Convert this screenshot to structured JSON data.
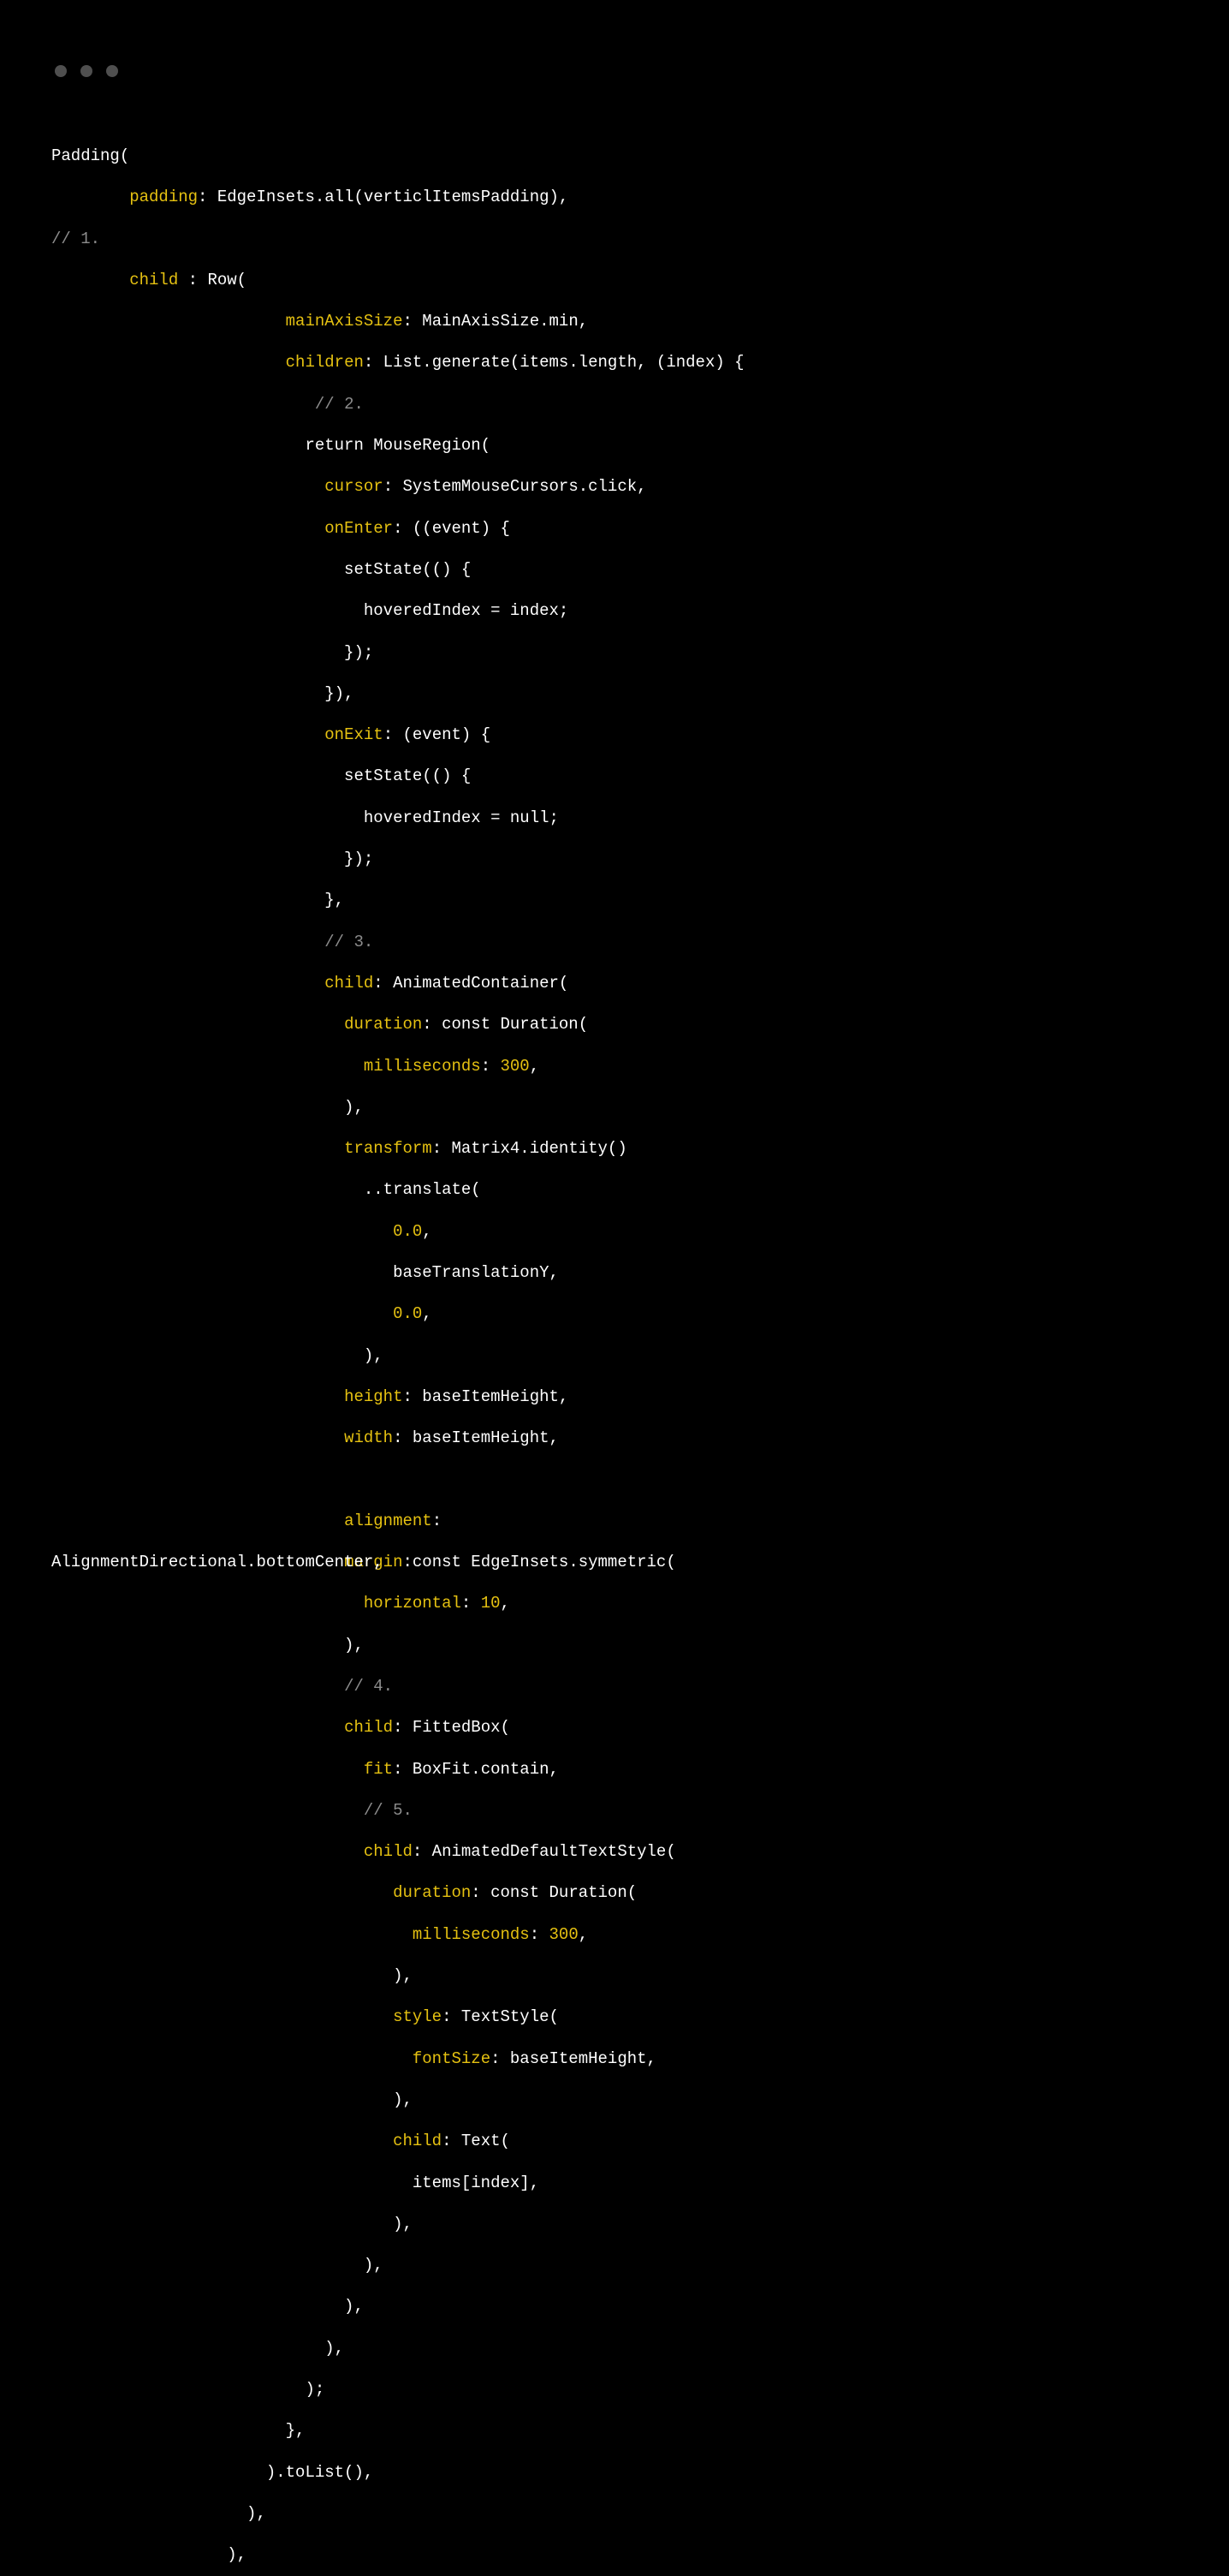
{
  "code": {
    "l01_a": "Padding(",
    "l02_a": "        ",
    "l02_key": "padding",
    "l02_b": ": EdgeInsets.all(verticlItemsPadding),",
    "l03_comment": "// 1.",
    "l04_a": "        ",
    "l04_key": "child",
    "l04_b": " : Row(",
    "l05_a": "                        ",
    "l05_key": "mainAxisSize",
    "l05_b": ": MainAxisSize.min,",
    "l06_a": "                        ",
    "l06_key": "children",
    "l06_b": ": List.generate(items.length, (index) {",
    "l07_a": "                           ",
    "l07_comment": "// 2.",
    "l08_a": "                          return MouseRegion(",
    "l09_a": "                            ",
    "l09_key": "cursor",
    "l09_b": ": SystemMouseCursors.click,",
    "l10_a": "                            ",
    "l10_key": "onEnter",
    "l10_b": ": ((event) {",
    "l11_a": "                              setState(() {",
    "l12_a": "                                hoveredIndex = index;",
    "l13_a": "                              });",
    "l14_a": "                            }),",
    "l15_a": "                            ",
    "l15_key": "onExit",
    "l15_b": ": (event) {",
    "l16_a": "                              setState(() {",
    "l17_a": "                                hoveredIndex = null;",
    "l18_a": "                              });",
    "l19_a": "                            },",
    "l20_a": "                            ",
    "l20_comment": "// 3.",
    "l21_a": "                            ",
    "l21_key": "child",
    "l21_b": ": AnimatedContainer(",
    "l22_a": "                              ",
    "l22_key": "duration",
    "l22_b": ": const Duration(",
    "l23_a": "                                ",
    "l23_key": "milliseconds",
    "l23_b": ": ",
    "l23_num": "300",
    "l23_c": ",",
    "l24_a": "                              ),",
    "l25_a": "                              ",
    "l25_key": "transform",
    "l25_b": ": Matrix4.identity()",
    "l26_a": "                                ..translate(",
    "l27_a": "                                   ",
    "l27_num": "0.0",
    "l27_b": ",",
    "l28_a": "                                   baseTranslationY,",
    "l29_a": "                                   ",
    "l29_num": "0.0",
    "l29_b": ",",
    "l30_a": "                                ),",
    "l31_a": "                              ",
    "l31_key": "height",
    "l31_b": ": baseItemHeight,",
    "l32_a": "                              ",
    "l32_key": "width",
    "l32_b": ": baseItemHeight,",
    "l33_blank": " ",
    "l34_mid": "                              ",
    "l34_key": "alignment",
    "l34_mid_b": ":",
    "l34_left": "AlignmentDirectional.bottomCenter,",
    "l35_mid_a": "                              ",
    "l35_mid_key": "margin",
    "l35_mid_b": ":const EdgeInsets.symmetric(",
    "l36_a": "                                ",
    "l36_key": "horizontal",
    "l36_b": ": ",
    "l36_num": "10",
    "l36_c": ",",
    "l37_a": "                              ),",
    "l38_a": "                              ",
    "l38_comment": "// 4.",
    "l39_a": "                              ",
    "l39_key": "child",
    "l39_b": ": FittedBox(",
    "l40_a": "                                ",
    "l40_key": "fit",
    "l40_b": ": BoxFit.contain,",
    "l41_a": "                                ",
    "l41_comment": "// 5.",
    "l42_a": "                                ",
    "l42_key": "child",
    "l42_b": ": AnimatedDefaultTextStyle(",
    "l43_a": "                                   ",
    "l43_key": "duration",
    "l43_b": ": const Duration(",
    "l44_a": "                                     ",
    "l44_key": "milliseconds",
    "l44_b": ": ",
    "l44_num": "300",
    "l44_c": ",",
    "l45_a": "                                   ),",
    "l46_a": "                                   ",
    "l46_key": "style",
    "l46_b": ": TextStyle(",
    "l47_a": "                                     ",
    "l47_key": "fontSize",
    "l47_b": ": baseItemHeight,",
    "l48_a": "                                   ),",
    "l49_a": "                                   ",
    "l49_key": "child",
    "l49_b": ": Text(",
    "l50_a": "                                     items[index],",
    "l51_a": "                                   ),",
    "l52_a": "                                ),",
    "l53_a": "                              ),",
    "l54_a": "                            ),",
    "l55_a": "                          );",
    "l56_a": "                        },",
    "l57_a": "                      ).toList(),",
    "l58_a": "                    ),",
    "l59_a": "                  ),"
  }
}
